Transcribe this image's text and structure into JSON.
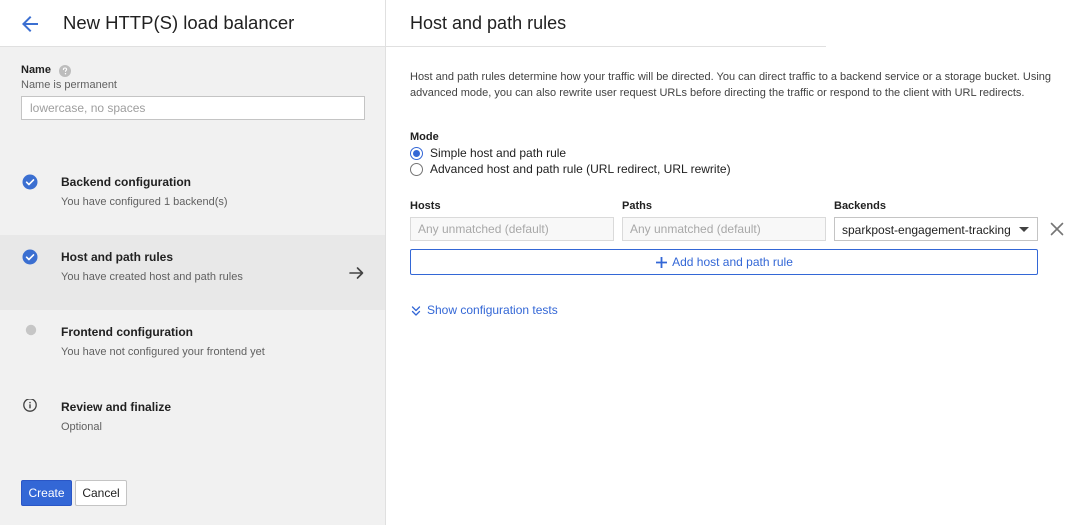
{
  "sidebar": {
    "title": "New HTTP(S) load balancer",
    "name": {
      "label": "Name",
      "hint": "Name is permanent",
      "placeholder": "lowercase, no spaces",
      "value": ""
    },
    "steps": [
      {
        "title": "Backend configuration",
        "subtitle": "You have configured 1 backend(s)",
        "status": "complete"
      },
      {
        "title": "Host and path rules",
        "subtitle": "You have created host and path rules",
        "status": "complete",
        "active": true
      },
      {
        "title": "Frontend configuration",
        "subtitle": "You have not configured your frontend yet",
        "status": "pending"
      },
      {
        "title": "Review and finalize",
        "subtitle": "Optional",
        "status": "info"
      }
    ],
    "create_label": "Create",
    "cancel_label": "Cancel"
  },
  "main": {
    "title": "Host and path rules",
    "description": "Host and path rules determine how your traffic will be directed. You can direct traffic to a backend service or a storage bucket. Using advanced mode, you can also rewrite user request URLs before directing the traffic or respond to the client with URL redirects.",
    "mode": {
      "label": "Mode",
      "options": [
        {
          "label": "Simple host and path rule",
          "checked": true
        },
        {
          "label": "Advanced host and path rule (URL redirect, URL rewrite)",
          "checked": false
        }
      ]
    },
    "rules": {
      "hosts_label": "Hosts",
      "paths_label": "Paths",
      "backends_label": "Backends",
      "hosts_placeholder": "Any unmatched (default)",
      "paths_placeholder": "Any unmatched (default)",
      "backend_value": "sparkpost-engagement-tracking"
    },
    "add_rule_label": "Add host and path rule",
    "config_tests_label": "Show configuration tests"
  },
  "colors": {
    "accent": "#3367d6",
    "check": "#3b6fd1",
    "pending": "#c6c6c6"
  },
  "icons": [
    "back-arrow-icon",
    "help-icon",
    "check-circle-icon",
    "pending-dot-icon",
    "info-icon",
    "arrow-right-icon",
    "close-icon",
    "plus-icon",
    "chevron-down-icon"
  ]
}
